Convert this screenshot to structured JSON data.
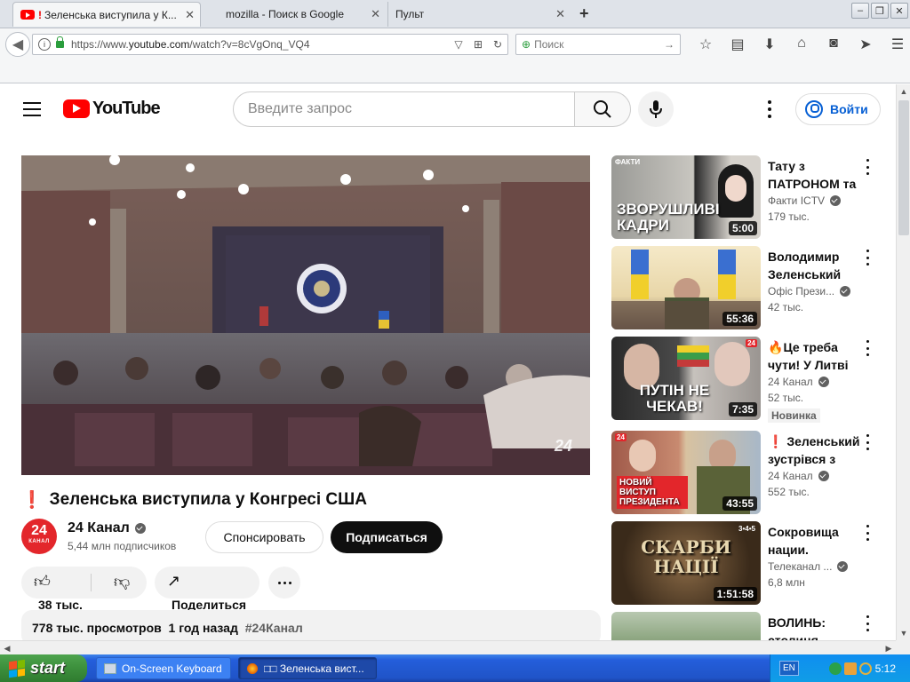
{
  "browser": {
    "tabs": [
      {
        "label": "Зеленська виступила у К...",
        "active": true
      },
      {
        "label": "mozilla - Поиск в Google",
        "active": false
      },
      {
        "label": "Пульт",
        "active": false
      }
    ],
    "url_prefix": "https://www.",
    "url_domain": "youtube.com",
    "url_path": "/watch?v=8cVgOnq_VQ4",
    "search_placeholder": "Поиск",
    "toolbar_icons": [
      "star-icon",
      "reader-icon",
      "download-icon",
      "home-icon",
      "pocket-icon",
      "send-icon",
      "menu-icon"
    ]
  },
  "youtube": {
    "logo_text": "YouTube",
    "search_placeholder": "Введите запрос",
    "signin_label": "Войти",
    "video": {
      "title": "Зеленська виступила у Конгресі США",
      "title_prefix": "❗",
      "channel": "24 Канал",
      "channel_avatar_text": "24",
      "channel_avatar_sub": "КАНАЛ",
      "subscribers": "5,44 млн подписчиков",
      "sponsor_label": "Спонсировать",
      "subscribe_label": "Подписаться",
      "likes": "38 тыс.",
      "share_label": "Поделиться",
      "views": "778 тыс. просмотров",
      "posted": "1 год назад",
      "hashtag": "#24Канал",
      "watermark": "24"
    },
    "related": [
      {
        "title": "Тату з ПАТРОНОМ та",
        "channel": "Факти ICTV",
        "views": "179 тыс.",
        "duration": "5:00",
        "thumb_text": "ЗВОРУШЛИВІ КАДРИ",
        "thumb_tag": "ФАКТИ",
        "badge": ""
      },
      {
        "title": "Володимир Зеленський",
        "channel": "Офіс Прези...",
        "views": "42 тыс.",
        "duration": "55:36",
        "thumb_text": "",
        "thumb_tag": "",
        "badge": ""
      },
      {
        "title": "Це треба чути! У Литві",
        "title_prefix": "🔥",
        "channel": "24 Канал",
        "views": "52 тыс.",
        "duration": "7:35",
        "thumb_text": "ПУТІН НЕ ЧЕКАВ!",
        "thumb_tag": "24",
        "badge": "Новинка"
      },
      {
        "title": "Зеленський зустрівся з",
        "title_prefix": "❗",
        "channel": "24 Канал",
        "views": "552 тыс.",
        "duration": "43:55",
        "thumb_text": "НОВИЙ ВИСТУП ПРЕЗИДЕНТА",
        "thumb_tag": "24",
        "badge": ""
      },
      {
        "title": "Сокровища нации.",
        "channel": "Телеканал ...",
        "views": "6,8 млн",
        "duration": "1:51:58",
        "thumb_text": "СКАРБИ НАЦІЇ",
        "thumb_tag": "3•4•5",
        "badge": ""
      },
      {
        "title": "ВОЛИНЬ: столиця",
        "channel": "",
        "views": "",
        "duration": "",
        "thumb_text": "",
        "thumb_tag": "",
        "badge": ""
      }
    ]
  },
  "taskbar": {
    "start_label": "start",
    "tasks": [
      {
        "label": "On-Screen Keyboard"
      },
      {
        "label": "□□ Зеленська вист..."
      }
    ],
    "lang": "EN",
    "clock": "5:12"
  }
}
